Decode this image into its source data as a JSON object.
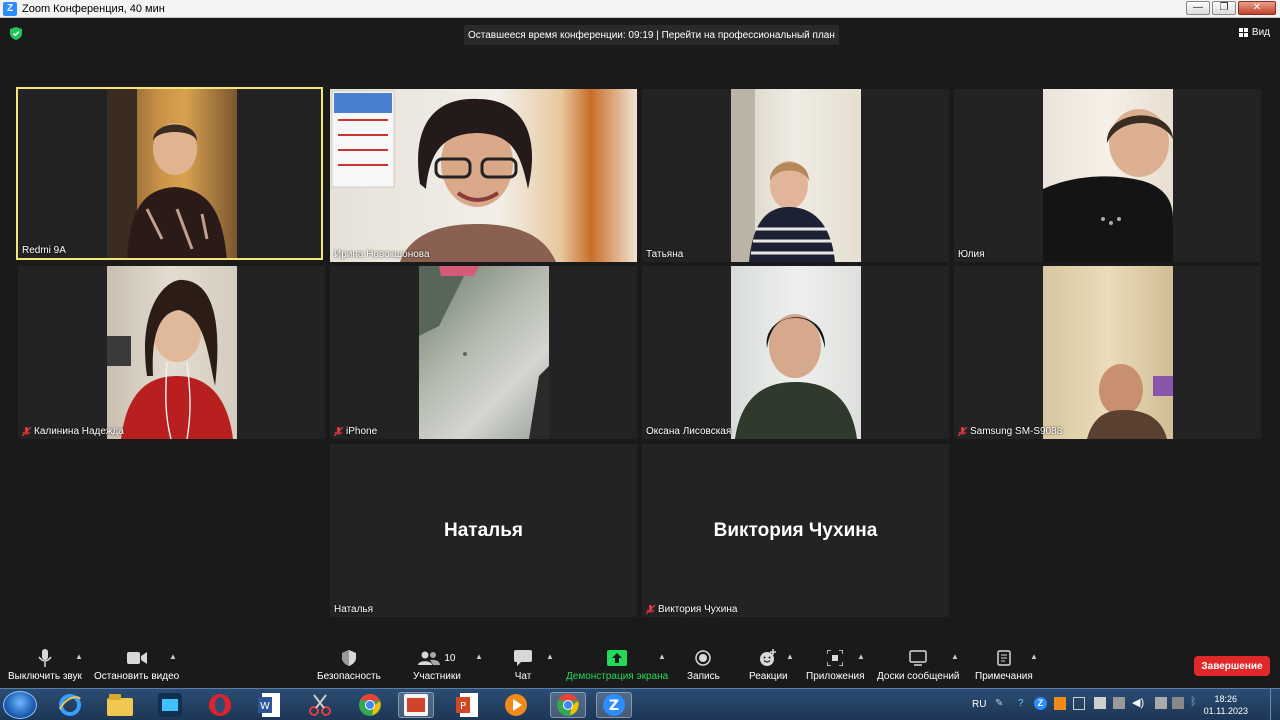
{
  "window": {
    "title": "Zoom Конференция, 40 мин",
    "minimize": "—",
    "maximize": "❐",
    "close": "✕"
  },
  "topbar": {
    "timer_text": "Оставшееся время конференции: 09:19 | Перейти на профессиональный план",
    "view_label": "Вид"
  },
  "participants": [
    {
      "name": "Redmi 9A",
      "active_speaker": true,
      "muted": false
    },
    {
      "name": "Ирина Новокшонова",
      "muted": false
    },
    {
      "name": "Татьяна",
      "muted": false
    },
    {
      "name": "Юлия",
      "muted": false
    },
    {
      "name": "Калинина Надежда",
      "muted": true
    },
    {
      "name": "iPhone",
      "muted": true
    },
    {
      "name": "Оксана Лисовская",
      "muted": false
    },
    {
      "name": "Samsung SM-S9088",
      "muted": true
    },
    {
      "name": "Наталья",
      "display": "Наталья",
      "muted": false,
      "video_off": true
    },
    {
      "name": "Виктория Чухина",
      "display": "Виктория Чухина",
      "muted": true,
      "video_off": true
    }
  ],
  "toolbar": {
    "mute": "Выключить звук",
    "video": "Остановить видео",
    "security": "Безопасность",
    "participants": "Участники",
    "participants_count": "10",
    "chat": "Чат",
    "share": "Демонстрация экрана",
    "record": "Запись",
    "reactions": "Реакции",
    "apps": "Приложения",
    "whiteboards": "Доски сообщений",
    "notes": "Примечания",
    "end": "Завершение",
    "share_color": "#23d959",
    "end_color": "#e02828"
  },
  "taskbar": {
    "apps": [
      "internet-explorer",
      "file-explorer",
      "video-app",
      "opera",
      "word",
      "scissors-app",
      "chrome",
      "presentation-app",
      "powerpoint",
      "media-player",
      "chrome-active",
      "zoom"
    ],
    "lang": "RU",
    "time": "18:26",
    "date": "01.11.2023"
  }
}
